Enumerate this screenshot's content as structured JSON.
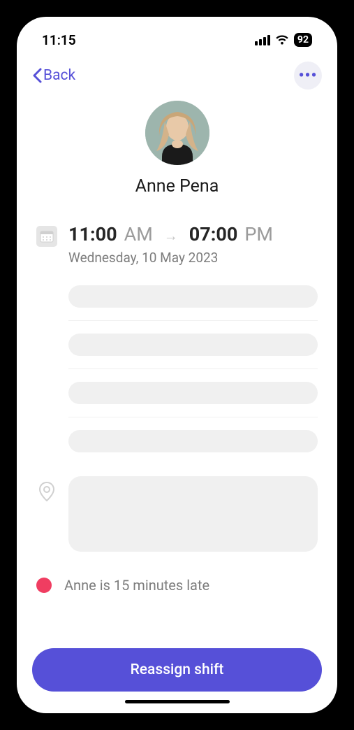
{
  "status_bar": {
    "time": "11:15",
    "battery": "92"
  },
  "nav": {
    "back_label": "Back"
  },
  "profile": {
    "name": "Anne Pena"
  },
  "shift": {
    "start_time": "11:00",
    "start_ampm": "AM",
    "end_time": "07:00",
    "end_ampm": "PM",
    "date": "Wednesday, 10 May 2023"
  },
  "status": {
    "color": "#f03d61",
    "message": "Anne is 15 minutes late"
  },
  "actions": {
    "reassign_label": "Reassign shift"
  }
}
